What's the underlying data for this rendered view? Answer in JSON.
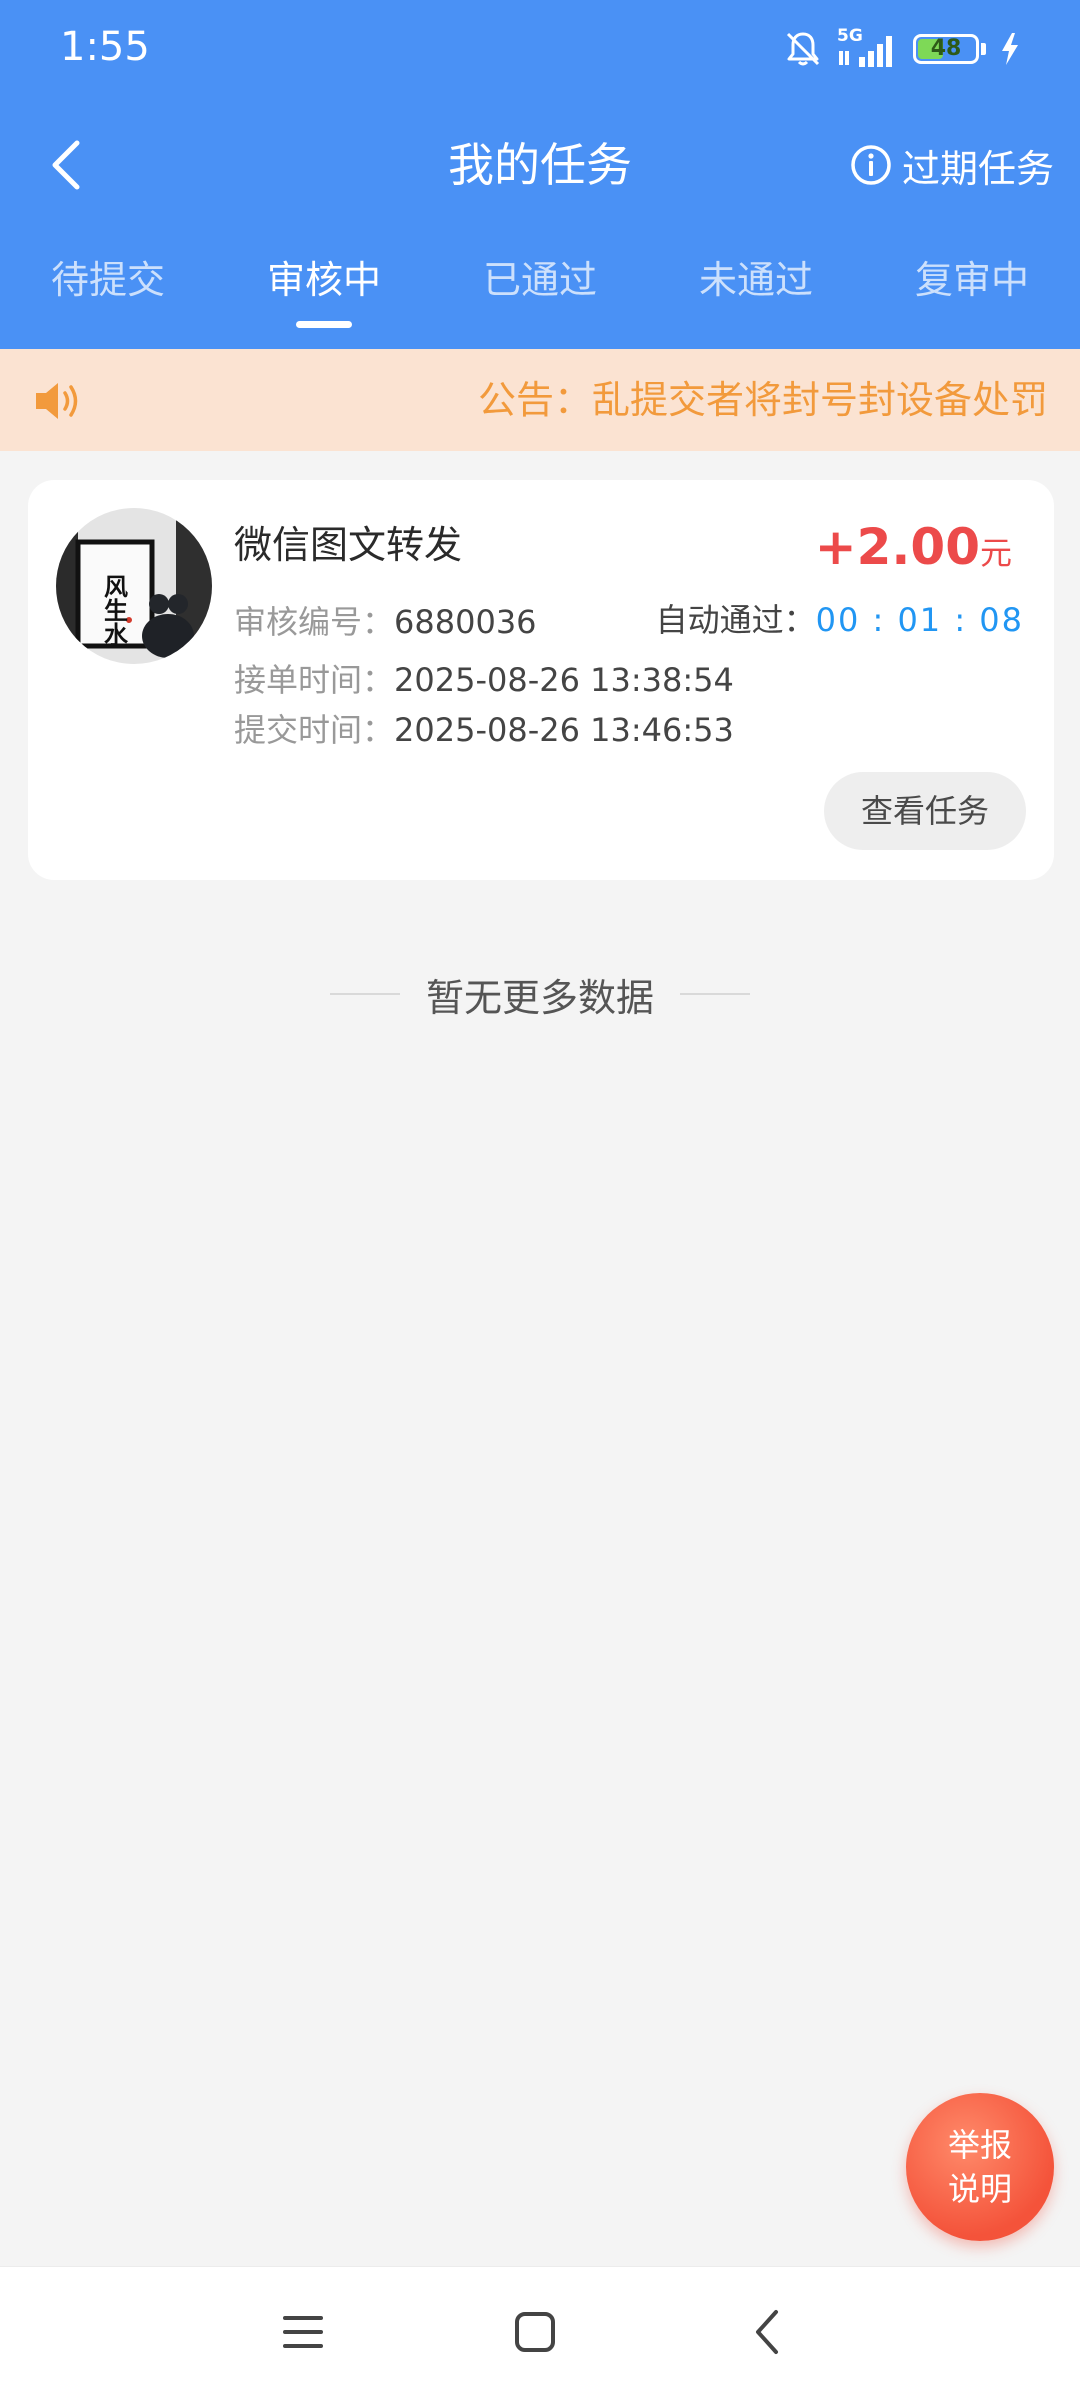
{
  "status_bar": {
    "time": "1:55",
    "network": "5G",
    "battery_level": "48",
    "battery_fraction": 0.48,
    "icons": [
      "bell-mute-icon",
      "signal-icon",
      "battery-icon",
      "charging-icon"
    ]
  },
  "header": {
    "title": "我的任务",
    "expired_label": "过期任务",
    "background_color": "#4a91f5"
  },
  "tabs": [
    {
      "label": "待提交",
      "active": false
    },
    {
      "label": "审核中",
      "active": true
    },
    {
      "label": "已通过",
      "active": false
    },
    {
      "label": "未通过",
      "active": false
    },
    {
      "label": "复审中",
      "active": false
    }
  ],
  "notice": {
    "text": "公告：乱提交者将封号封设备处罚",
    "text_color": "#f29a3c",
    "background_color": "#fbe3d2"
  },
  "task": {
    "title": "微信图文转发",
    "avatar_text": "风生水",
    "reward_amount": "+2.00",
    "reward_unit": "元",
    "review_id_label": "审核编号：",
    "review_id": "6880036",
    "auto_pass_label": "自动通过：",
    "auto_pass_time": "00 : 01 : 08",
    "accept_time_label": "接单时间：",
    "accept_time": "2025-08-26 13:38:54",
    "submit_time_label": "提交时间：",
    "submit_time": "2025-08-26 13:46:53",
    "view_button": "查看任务",
    "reward_color": "#ec4a4a",
    "timer_color": "#2196f3"
  },
  "empty_hint": "暂无更多数据",
  "fab": {
    "line1": "举报",
    "line2": "说明",
    "color": "#f4533a"
  },
  "system_nav": {
    "icons": [
      "menu-icon",
      "home-icon",
      "back-icon"
    ]
  }
}
